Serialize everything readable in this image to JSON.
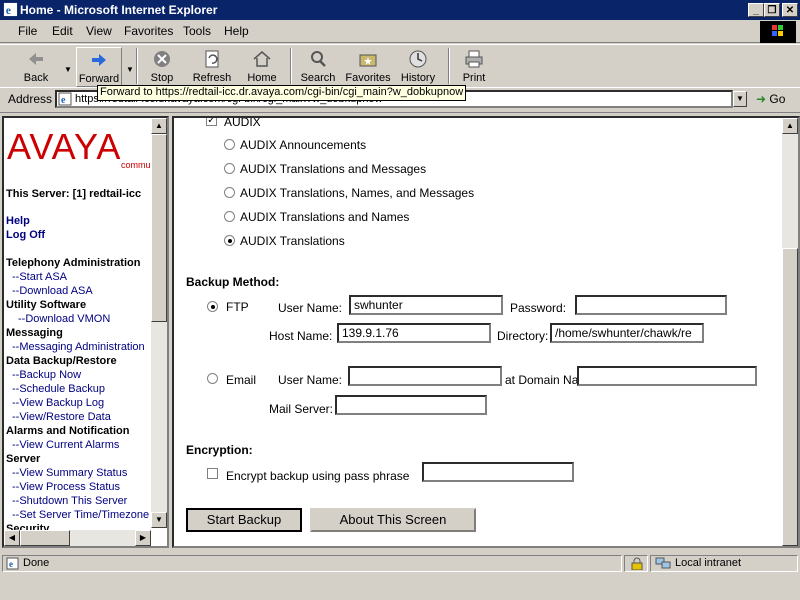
{
  "window": {
    "title": "Home - Microsoft Internet Explorer"
  },
  "menu": [
    "File",
    "Edit",
    "View",
    "Favorites",
    "Tools",
    "Help"
  ],
  "toolbar": {
    "back": "Back",
    "forward": "Forward",
    "stop": "Stop",
    "refresh": "Refresh",
    "home": "Home",
    "search": "Search",
    "favorites": "Favorites",
    "history": "History",
    "print": "Print"
  },
  "address": {
    "label": "Address",
    "url": "https://redtail-icc.dr.avaya.com/cgi-bin/cgi_main?w_dobkupnow",
    "go": "Go",
    "tooltip": "Forward to https://redtail-icc.dr.avaya.com/cgi-bin/cgi_main?w_dobkupnow"
  },
  "sidebar": {
    "logo": "AVAYA",
    "logo_sub": "communicat",
    "server": "This Server: [1] redtail-icc",
    "help": "Help",
    "logoff": "Log Off",
    "sections": [
      {
        "title": "Telephony Administration",
        "links": [
          "--Start ASA",
          "--Download ASA"
        ]
      },
      {
        "title": "Utility Software",
        "links": [
          "--Download VMON"
        ]
      },
      {
        "title": "Messaging",
        "links": [
          "--Messaging Administration"
        ]
      },
      {
        "title": "Data Backup/Restore",
        "links": [
          "--Backup Now",
          "--Schedule Backup",
          "--View Backup Log",
          "--View/Restore Data"
        ]
      },
      {
        "title": "Alarms and Notification",
        "links": [
          "--View Current Alarms"
        ]
      },
      {
        "title": "Server",
        "links": [
          "--View Summary Status",
          "--View Process Status",
          "--Shutdown This Server",
          "--Set Server Time/Timezone"
        ]
      },
      {
        "title": "Security",
        "links": []
      }
    ]
  },
  "form": {
    "audix_label": "AUDIX",
    "audix_options": [
      "AUDIX Announcements",
      "AUDIX Translations and Messages",
      "AUDIX Translations, Names, and Messages",
      "AUDIX Translations and Names",
      "AUDIX Translations"
    ],
    "audix_selected": 4,
    "backup_method_heading": "Backup Method:",
    "ftp": {
      "label": "FTP",
      "user_label": "User Name:",
      "user_value": "swhunter",
      "password_label": "Password:",
      "password_value": "",
      "host_label": "Host Name:",
      "host_value": "139.9.1.76",
      "dir_label": "Directory:",
      "dir_value": "/home/swhunter/chawk/re"
    },
    "email": {
      "label": "Email",
      "user_label": "User Name:",
      "user_value": "",
      "domain_label": "at Domain Name:",
      "domain_value": "",
      "mail_label": "Mail Server:",
      "mail_value": ""
    },
    "encryption_heading": "Encryption:",
    "encrypt_label": "Encrypt backup using pass phrase",
    "encrypt_value": "",
    "start_button": "Start Backup",
    "about_button": "About This Screen"
  },
  "status": {
    "text": "Done",
    "zone": "Local intranet"
  },
  "colors": {
    "titlebar": "#0a246a",
    "avaya_red": "#cc0000",
    "link": "#000080"
  }
}
